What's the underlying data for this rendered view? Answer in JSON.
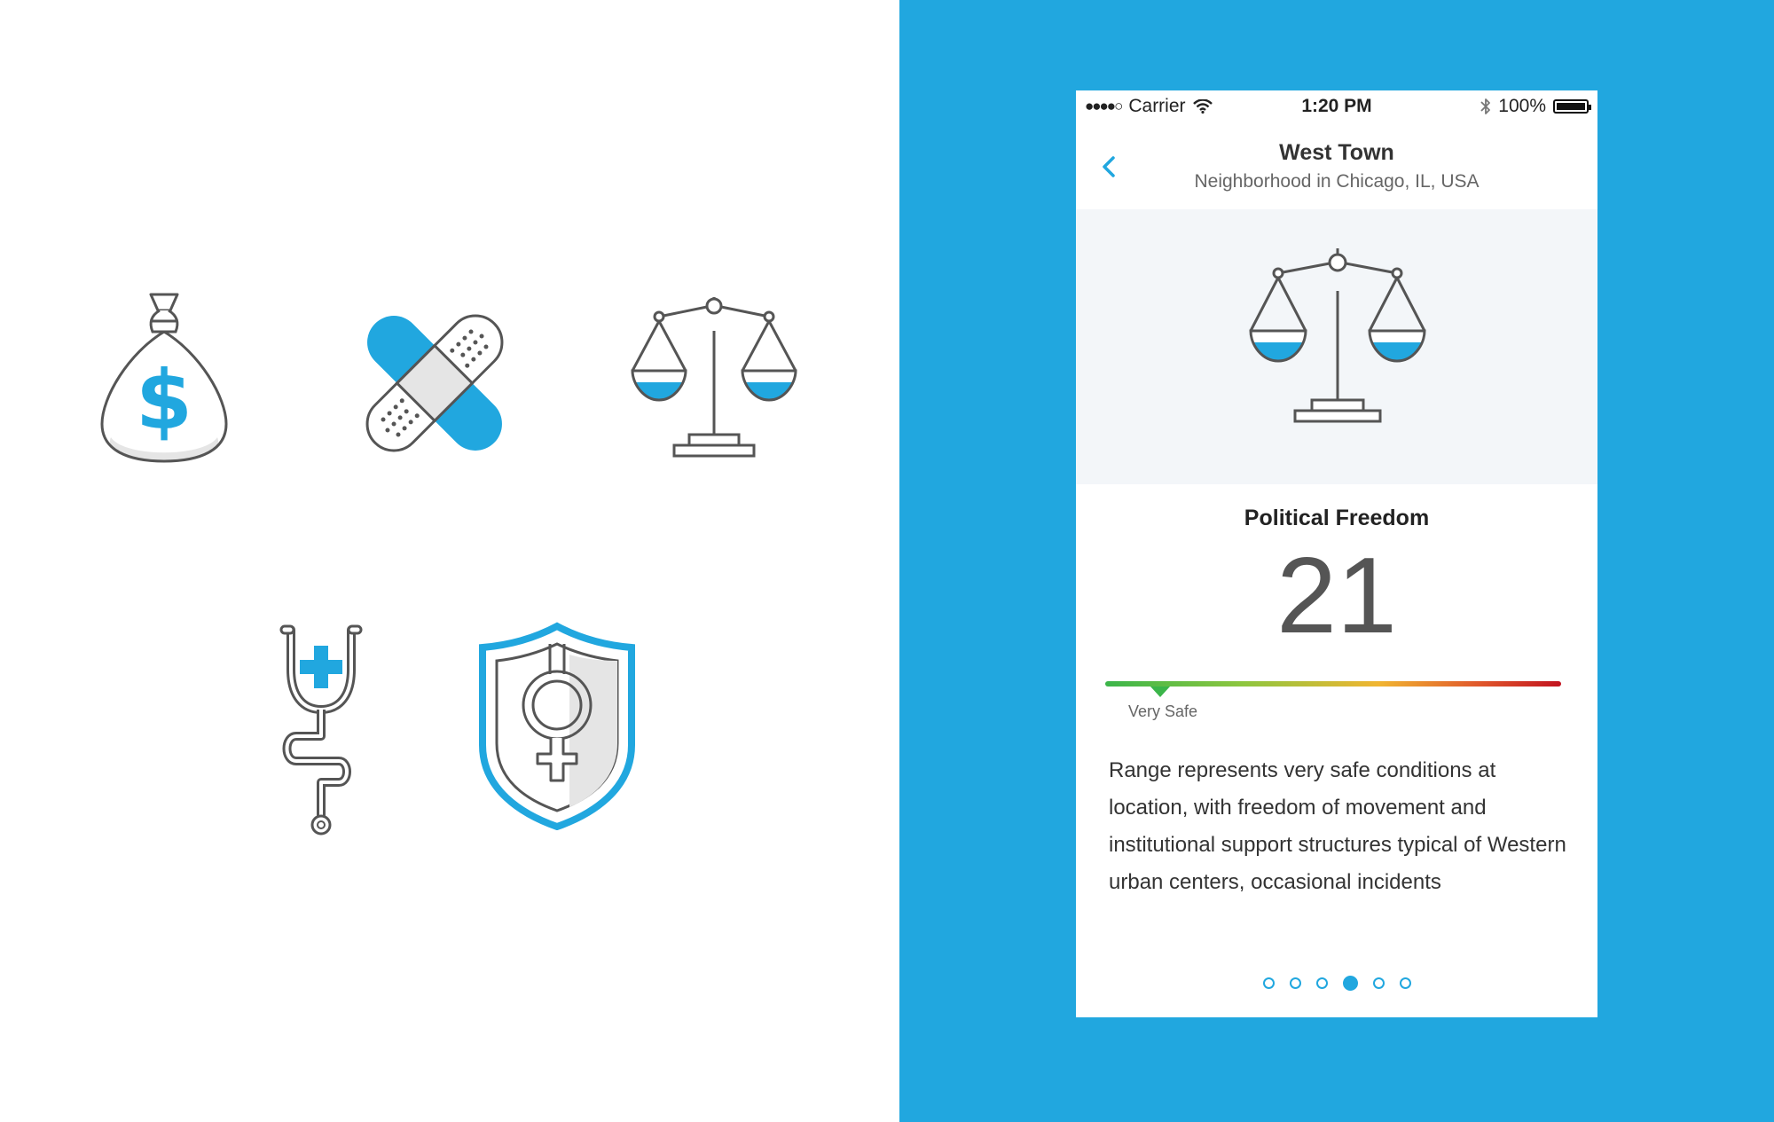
{
  "colors": {
    "accent_blue": "#21a7df",
    "icon_stroke": "#555555",
    "shade_gray": "#e5e5e5",
    "background_white": "#ffffff",
    "hero_background": "#f3f6f9",
    "gauge_start": "#3bb54a",
    "gauge_end": "#c2131f"
  },
  "icon_set": [
    "money-bag-icon",
    "bandage-icon",
    "scales-icon",
    "stethoscope-icon",
    "female-shield-icon"
  ],
  "status_bar": {
    "signal": "●●●●○",
    "carrier": "Carrier",
    "time": "1:20 PM",
    "battery": "100%",
    "battery_level": 1.0
  },
  "header": {
    "title": "West Town",
    "subtitle": "Neighborhood in Chicago, IL, USA"
  },
  "metric": {
    "title": "Political Freedom",
    "value": "21",
    "scale_label": "Very Safe",
    "scale_position": 0.12,
    "description": "Range represents very safe conditions at location, with freedom of movement and institutional support structures typical of Western urban centers, occasional incidents"
  },
  "pagination": {
    "total": 6,
    "current_index": 3
  }
}
